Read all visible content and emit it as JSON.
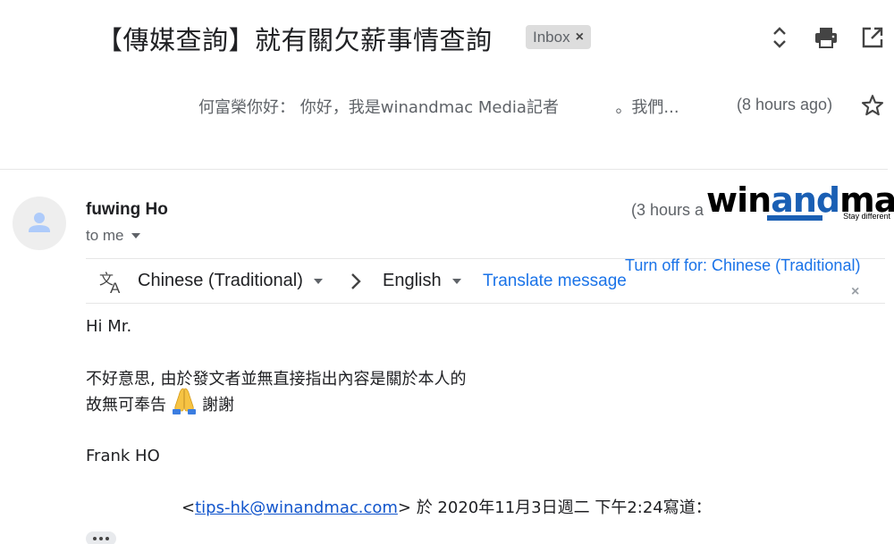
{
  "subject": "【傳媒查詢】就有關欠薪事情查詢",
  "label_chip": {
    "text": "Inbox",
    "close": "×"
  },
  "collapsed_message": {
    "snippet_part1": "何富榮你好： 你好，我是winandmac Media記者",
    "snippet_part2": "。我們...",
    "time": "(8 hours ago)"
  },
  "message": {
    "sender": "fuwing Ho",
    "recipient": "to me",
    "time": "(3 hours a"
  },
  "watermark": {
    "brand_pre": "win",
    "brand_and": "and",
    "brand_post": "mac",
    "tagline": "Stay different"
  },
  "translate_bar": {
    "source_language": "Chinese (Traditional)",
    "target_language": "English",
    "translate_label": "Translate message",
    "turn_off_label": "Turn off for: Chinese (Traditional)",
    "close": "×"
  },
  "body": {
    "greeting": "Hi Mr.",
    "line1": "不好意思, 由於發文者並無直接指出內容是關於本人的",
    "line2_a": "故無可奉告",
    "line2_b": "謝謝",
    "signature": "Frank HO"
  },
  "quoted": {
    "prefix": "<",
    "email": "tips-hk@winandmac.com",
    "suffix": "> 於 2020年11月3日週二 下午2:24寫道："
  },
  "icons": {
    "expand": "unfold-more-icon",
    "print": "print-icon",
    "open_new_window": "open-in-new-icon",
    "star": "star-icon",
    "avatar": "person-icon",
    "translate": "translate-icon",
    "pray": "folded-hands-emoji"
  },
  "colors": {
    "link": "#1a73e8",
    "brand_blue": "#1a5fb4",
    "chip_bg": "#dddddd"
  }
}
